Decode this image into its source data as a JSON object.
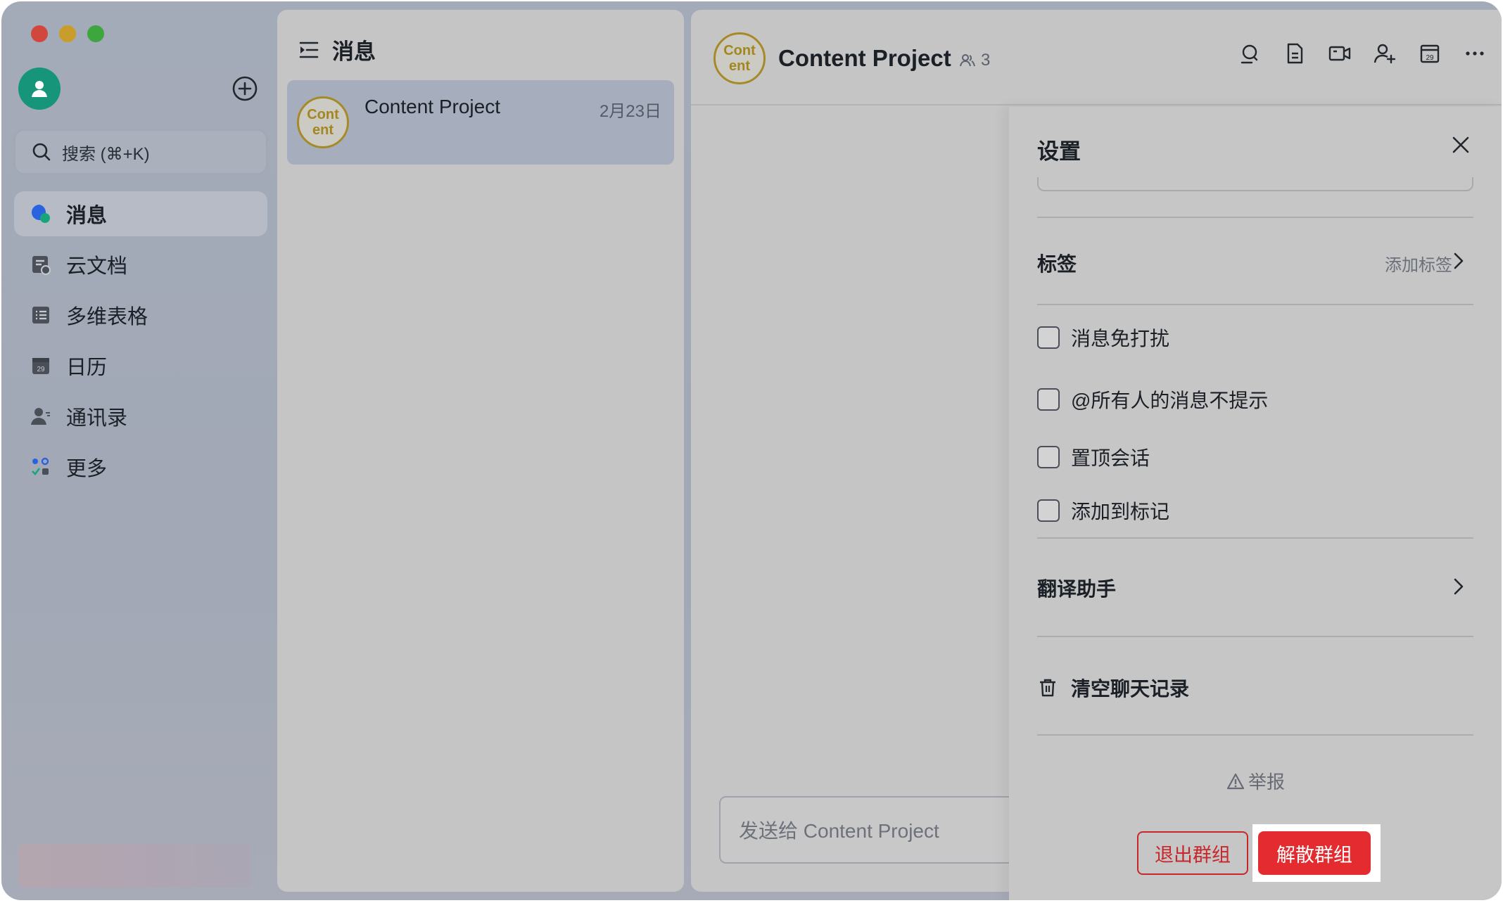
{
  "window": {
    "controls": [
      "close",
      "minimize",
      "zoom"
    ]
  },
  "sidebar": {
    "search_placeholder": "搜索 (⌘+K)",
    "items": [
      {
        "label": "消息",
        "icon": "messages-icon",
        "active": true
      },
      {
        "label": "云文档",
        "icon": "docs-icon",
        "active": false
      },
      {
        "label": "多维表格",
        "icon": "base-icon",
        "active": false
      },
      {
        "label": "日历",
        "icon": "calendar-icon",
        "active": false
      },
      {
        "label": "通讯录",
        "icon": "contacts-icon",
        "active": false
      },
      {
        "label": "更多",
        "icon": "more-apps-icon",
        "active": false
      }
    ]
  },
  "chatlist": {
    "title": "消息",
    "items": [
      {
        "name": "Content Project",
        "date": "2月23日",
        "avatar_line1": "Cont",
        "avatar_line2": "ent"
      }
    ]
  },
  "chat": {
    "title": "Content Project",
    "member_count": "3",
    "avatar_line1": "Cont",
    "avatar_line2": "ent",
    "composer_placeholder": "发送给 Content Project",
    "toolbar": [
      "search-chat-icon",
      "document-icon",
      "video-call-icon",
      "add-member-icon",
      "calendar-icon",
      "more-icon"
    ]
  },
  "settings": {
    "title": "设置",
    "tags_label": "标签",
    "tags_hint": "添加标签",
    "options": [
      {
        "label": "消息免打扰",
        "checked": false
      },
      {
        "label": "@所有人的消息不提示",
        "checked": false
      },
      {
        "label": "置顶会话",
        "checked": false
      },
      {
        "label": "添加到标记",
        "checked": false
      }
    ],
    "translate_label": "翻译助手",
    "clear_label": "清空聊天记录",
    "report_label": "举报",
    "exit_label": "退出群组",
    "dissolve_label": "解散群组"
  },
  "colors": {
    "accent_red": "#e42b2f",
    "avatar_green": "#16957a",
    "group_avatar_gold": "#a68a2a"
  }
}
